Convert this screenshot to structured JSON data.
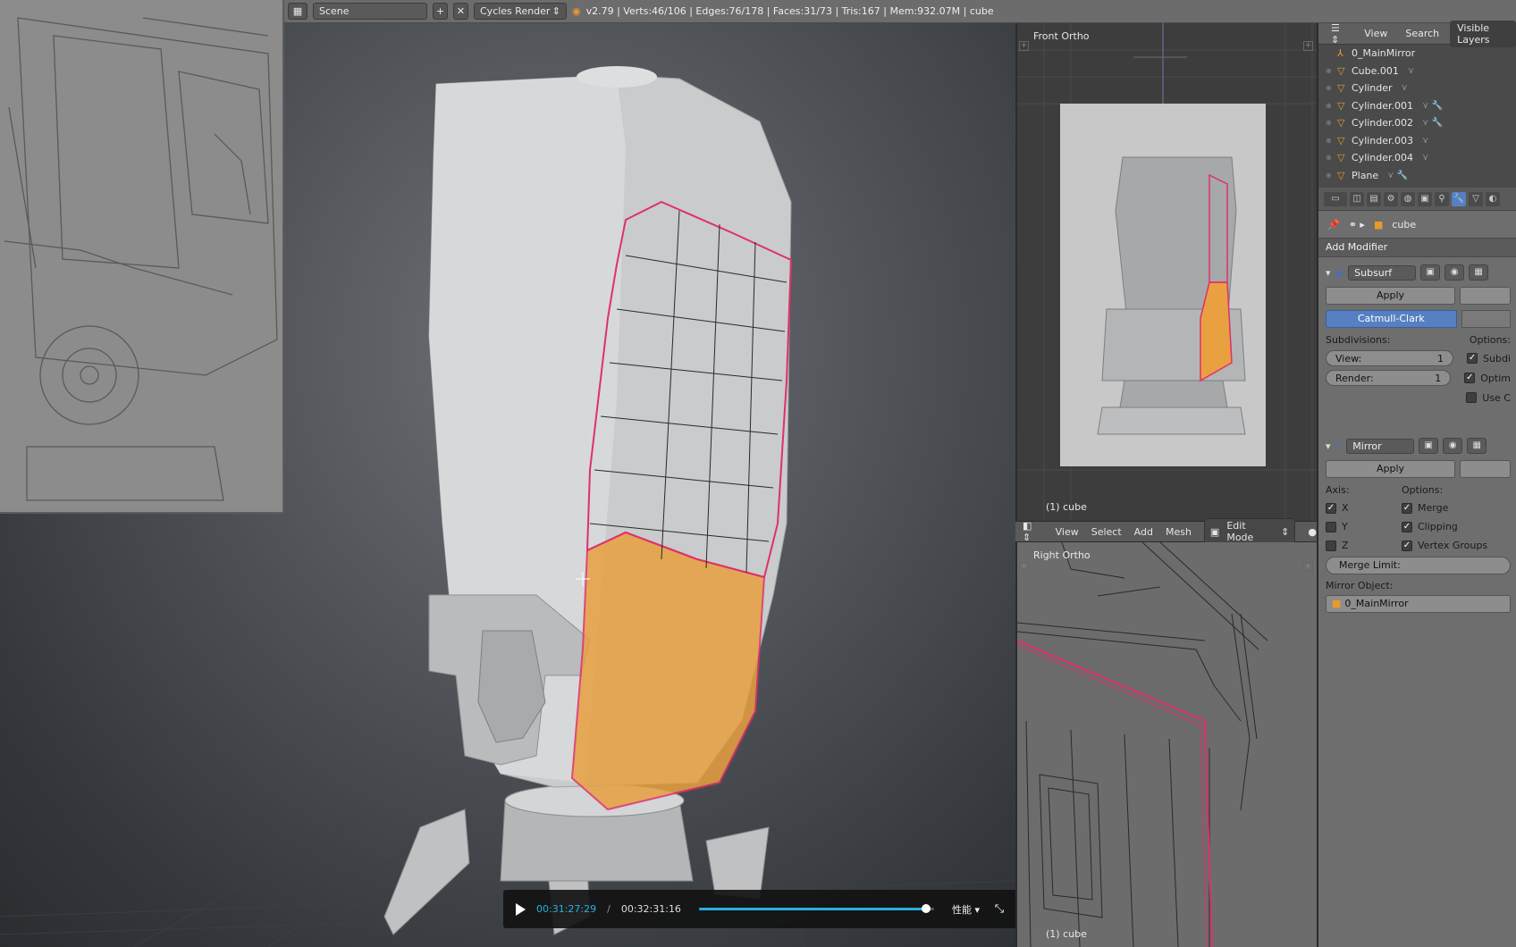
{
  "header": {
    "scene_name": "Scene",
    "render_engine": "Cycles Render",
    "stats": "v2.79 | Verts:46/106 | Edges:76/178 | Faces:31/73 | Tris:167 | Mem:932.07M | cube"
  },
  "viewport_front": {
    "label": "Front Ortho",
    "object_label": "(1) cube"
  },
  "viewport_right": {
    "label": "Right Ortho",
    "object_label": "(1) cube"
  },
  "view3d_header": {
    "view": "View",
    "select": "Select",
    "add": "Add",
    "mesh": "Mesh",
    "mode": "Edit Mode"
  },
  "outliner": {
    "tabs": [
      "View",
      "Search",
      "Visible Layers"
    ],
    "items": [
      {
        "name": "0_MainMirror",
        "icon": "empty-icon"
      },
      {
        "name": "Cube.001",
        "icon": "mesh-icon"
      },
      {
        "name": "Cylinder",
        "icon": "mesh-icon"
      },
      {
        "name": "Cylinder.001",
        "icon": "mesh-icon"
      },
      {
        "name": "Cylinder.002",
        "icon": "mesh-icon"
      },
      {
        "name": "Cylinder.003",
        "icon": "mesh-icon"
      },
      {
        "name": "Cylinder.004",
        "icon": "mesh-icon"
      },
      {
        "name": "Plane",
        "icon": "mesh-icon"
      }
    ]
  },
  "properties": {
    "context_object": "cube",
    "add_modifier": "Add Modifier",
    "subsurf": {
      "name": "Subsurf",
      "apply": "Apply",
      "algorithm": "Catmull-Clark",
      "subdivisions_label": "Subdivisions:",
      "options_label": "Options:",
      "view_label": "View:",
      "view_value": "1",
      "render_label": "Render:",
      "render_value": "1",
      "opt1": "Subdi",
      "opt2": "Optim",
      "opt3": "Use C"
    },
    "mirror": {
      "name": "Mirror",
      "apply": "Apply",
      "axis_label": "Axis:",
      "options_label": "Options:",
      "x": "X",
      "y": "Y",
      "z": "Z",
      "merge": "Merge",
      "clipping": "Clipping",
      "vertex_groups": "Vertex Groups",
      "merge_limit": "Merge Limit:",
      "mirror_object_label": "Mirror Object:",
      "mirror_object": "0_MainMirror"
    }
  },
  "player": {
    "current_time": "00:31:27:29",
    "separator": "/",
    "total_time": "00:32:31:16",
    "progress": 0.967,
    "quality": "性能"
  },
  "colors": {
    "accent_blue": "#5680c2",
    "selection_orange": "#e8a040",
    "edge_pink": "#e0306a",
    "player_accent": "#27b0e0"
  }
}
